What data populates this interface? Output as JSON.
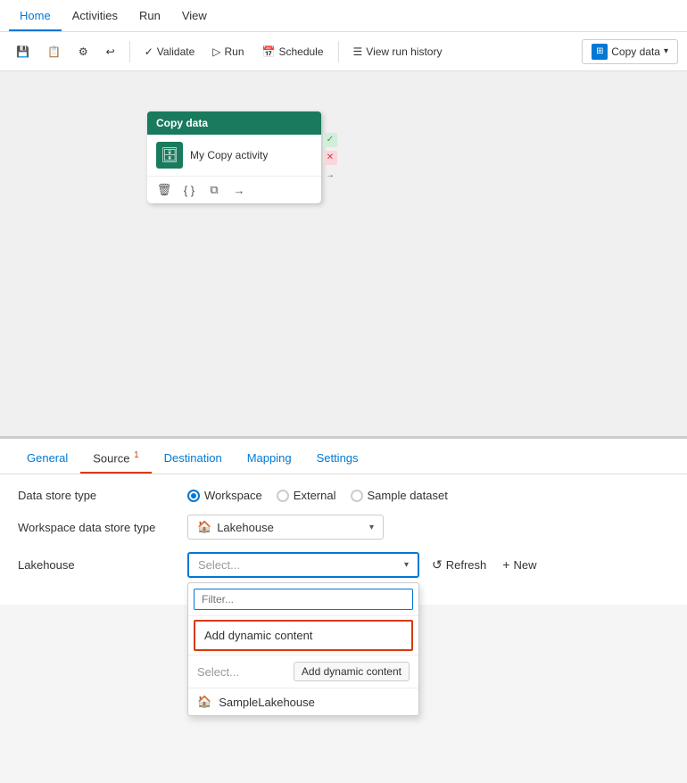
{
  "nav": {
    "tabs": [
      {
        "id": "home",
        "label": "Home",
        "active": true
      },
      {
        "id": "activities",
        "label": "Activities",
        "active": false
      },
      {
        "id": "run",
        "label": "Run",
        "active": false
      },
      {
        "id": "view",
        "label": "View",
        "active": false
      }
    ]
  },
  "toolbar": {
    "save_label": "Save",
    "publish_label": "Publish",
    "settings_label": "Settings",
    "undo_label": "Undo",
    "validate_label": "Validate",
    "run_label": "Run",
    "schedule_label": "Schedule",
    "view_run_history_label": "View run history",
    "copy_data_label": "Copy data"
  },
  "canvas": {
    "activity": {
      "title": "Copy data",
      "name": "My Copy activity",
      "icon": "🗄"
    }
  },
  "panel": {
    "tabs": [
      {
        "id": "general",
        "label": "General"
      },
      {
        "id": "source",
        "label": "Source",
        "active": true,
        "badge": "1"
      },
      {
        "id": "destination",
        "label": "Destination"
      },
      {
        "id": "mapping",
        "label": "Mapping"
      },
      {
        "id": "settings",
        "label": "Settings"
      }
    ],
    "form": {
      "data_store_type_label": "Data store type",
      "workspace_data_store_type_label": "Workspace data store type",
      "lakehouse_label": "Lakehouse",
      "radio_options": [
        {
          "id": "workspace",
          "label": "Workspace",
          "checked": true
        },
        {
          "id": "external",
          "label": "External",
          "checked": false
        },
        {
          "id": "sample_dataset",
          "label": "Sample dataset",
          "checked": false
        }
      ],
      "workspace_ds_type": "Lakehouse",
      "lakehouse_placeholder": "Select...",
      "filter_placeholder": "Filter...",
      "add_dynamic_content": "Add dynamic content",
      "select_label": "Select...",
      "add_dynamic_tooltip": "Add dynamic content",
      "sample_lakehouse_icon": "🏠",
      "sample_lakehouse_label": "SampleLakehouse"
    },
    "buttons": {
      "refresh_label": "Refresh",
      "new_label": "New"
    }
  }
}
